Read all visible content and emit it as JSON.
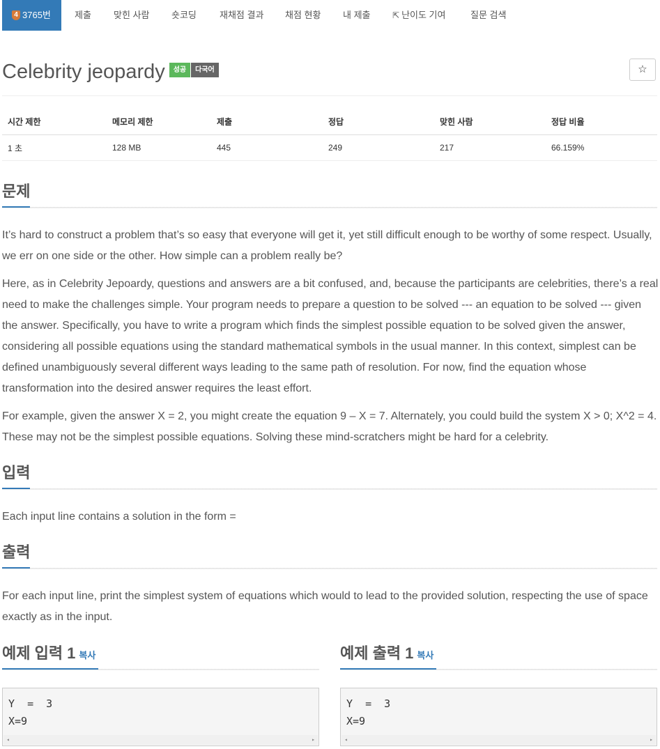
{
  "tabs": {
    "problem": {
      "tier": "4",
      "label": "3765번"
    },
    "submit": "제출",
    "solved_users": "맞힌 사람",
    "short_coding": "숏코딩",
    "rejudge": "재채점 결과",
    "status": "채점 현황",
    "my_submissions": "내 제출",
    "difficulty": "난이도 기여",
    "questions": "질문 검색"
  },
  "problem": {
    "title": "Celebrity jeopardy",
    "badge_success": "성공",
    "badge_multilang": "다국어",
    "star": "☆"
  },
  "info_table": {
    "headers": [
      "시간 제한",
      "메모리 제한",
      "제출",
      "정답",
      "맞힌 사람",
      "정답 비율"
    ],
    "row": [
      "1 초",
      "128 MB",
      "445",
      "249",
      "217",
      "66.159%"
    ]
  },
  "sections": {
    "description": {
      "heading": "문제",
      "paragraphs": [
        "It’s hard to construct a problem that’s so easy that everyone will get it, yet still difficult enough to be worthy of some respect. Usually, we err on one side or the other. How simple can a problem really be?",
        "Here, as in Celebrity Jepoardy, questions and answers are a bit confused, and, because the participants are celebrities, there’s a real need to make the challenges simple. Your program needs to prepare a question to be solved --- an equation to be solved --- given the answer. Specifically, you have to write a program which finds the simplest possible equation to be solved given the answer, considering all possible equations using the standard mathematical symbols in the usual manner. In this context, simplest can be defined unambiguously several different ways leading to the same path of resolution. For now, find the equation whose transformation into the desired answer requires the least effort.",
        "For example, given the answer X = 2, you might create the equation 9 – X = 7. Alternately, you could build the system X > 0; X^2 = 4. These may not be the simplest possible equations. Solving these mind-scratchers might be hard for a celebrity."
      ]
    },
    "input": {
      "heading": "입력",
      "text": "Each input line contains a solution in the form ="
    },
    "output": {
      "heading": "출력",
      "text": "For each input line, print the simplest system of equations which would to lead to the provided solution, respecting the use of space exactly as in the input."
    }
  },
  "samples": {
    "input": {
      "heading": "예제 입력 1",
      "copy": "복사",
      "code": "Y  =  3\nX=9"
    },
    "output": {
      "heading": "예제 출력 1",
      "copy": "복사",
      "code": "Y  =  3\nX=9"
    }
  },
  "icons": {
    "scroll_left": "◂",
    "scroll_right": "▸",
    "external_link": "⇱"
  },
  "colors": {
    "accent": "#337ab7",
    "success": "#5cb85c",
    "multilang": "#666666",
    "tier_bronze": "#d77b3a"
  }
}
